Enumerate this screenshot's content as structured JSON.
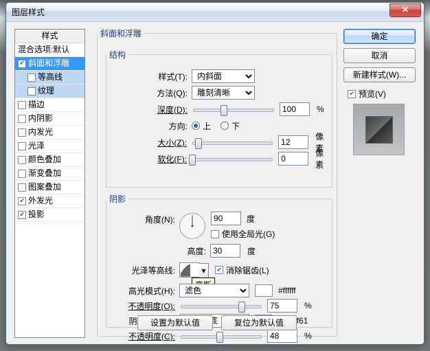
{
  "title": "图层样式",
  "close_glyph": "✕",
  "sidebar": {
    "header": "样式",
    "items": [
      {
        "label": "混合选项:默认",
        "cb": null
      },
      {
        "label": "斜面和浮雕",
        "cb": true,
        "sel": true
      },
      {
        "label": "等高线",
        "cb": false,
        "sub": true,
        "subsel": true
      },
      {
        "label": "纹理",
        "cb": false,
        "sub": true,
        "subsel": true
      },
      {
        "label": "描边",
        "cb": false
      },
      {
        "label": "内阴影",
        "cb": false
      },
      {
        "label": "内发光",
        "cb": false
      },
      {
        "label": "光泽",
        "cb": false
      },
      {
        "label": "颜色叠加",
        "cb": false
      },
      {
        "label": "渐变叠加",
        "cb": false
      },
      {
        "label": "图案叠加",
        "cb": false
      },
      {
        "label": "外发光",
        "cb": true
      },
      {
        "label": "投影",
        "cb": true
      }
    ]
  },
  "right": {
    "ok": "确定",
    "cancel": "取消",
    "newstyle": "新建样式(W)...",
    "preview_cb": true,
    "preview_label": "预览(V)"
  },
  "groups": {
    "outer": "斜面和浮雕",
    "struc": "结构",
    "shade": "阴影"
  },
  "struc": {
    "style_label": "样式(T):",
    "style_value": "内斜面",
    "method_label": "方法(Q):",
    "method_value": "雕刻清晰",
    "depth_label": "深度(D):",
    "depth_value": "100",
    "depth_unit": "%",
    "depth_pct": 38,
    "dir_label": "方向:",
    "dir_up": "上",
    "dir_down": "下",
    "dir": "up",
    "size_label": "大小(Z):",
    "size_value": "12",
    "size_unit": "像素",
    "size_pct": 8,
    "soft_label": "软化(F):",
    "soft_value": "0",
    "soft_unit": "像素",
    "soft_pct": 0
  },
  "shade": {
    "angle_label": "角度(N):",
    "angle_value": "90",
    "angle_unit": "度",
    "global_cb": false,
    "global_label": "使用全局光(G)",
    "alt_label": "高度:",
    "alt_value": "30",
    "alt_unit": "度",
    "contour_label": "光泽等高线:",
    "contour_tooltip": "高斯",
    "aa_cb": true,
    "aa_label": "消除锯齿(L)",
    "hmode_label": "高光模式(H):",
    "hmode_value": "滤色",
    "hcolor": "#ffffff",
    "hcolor_txt": "#ffffff",
    "hopa_label": "不透明度(O):",
    "hopa_value": "75",
    "hopa_unit": "%",
    "hopa_pct": 75,
    "smode_label": "阴影模式(A):",
    "smode_value": "正片叠底",
    "scolor": "#a47f61",
    "scolor_txt": "#a47f61",
    "sopa_label": "不透明度(C):",
    "sopa_value": "48",
    "sopa_unit": "%",
    "sopa_pct": 48
  },
  "bottom": {
    "make": "设置为默认值",
    "reset": "复位为默认值"
  }
}
